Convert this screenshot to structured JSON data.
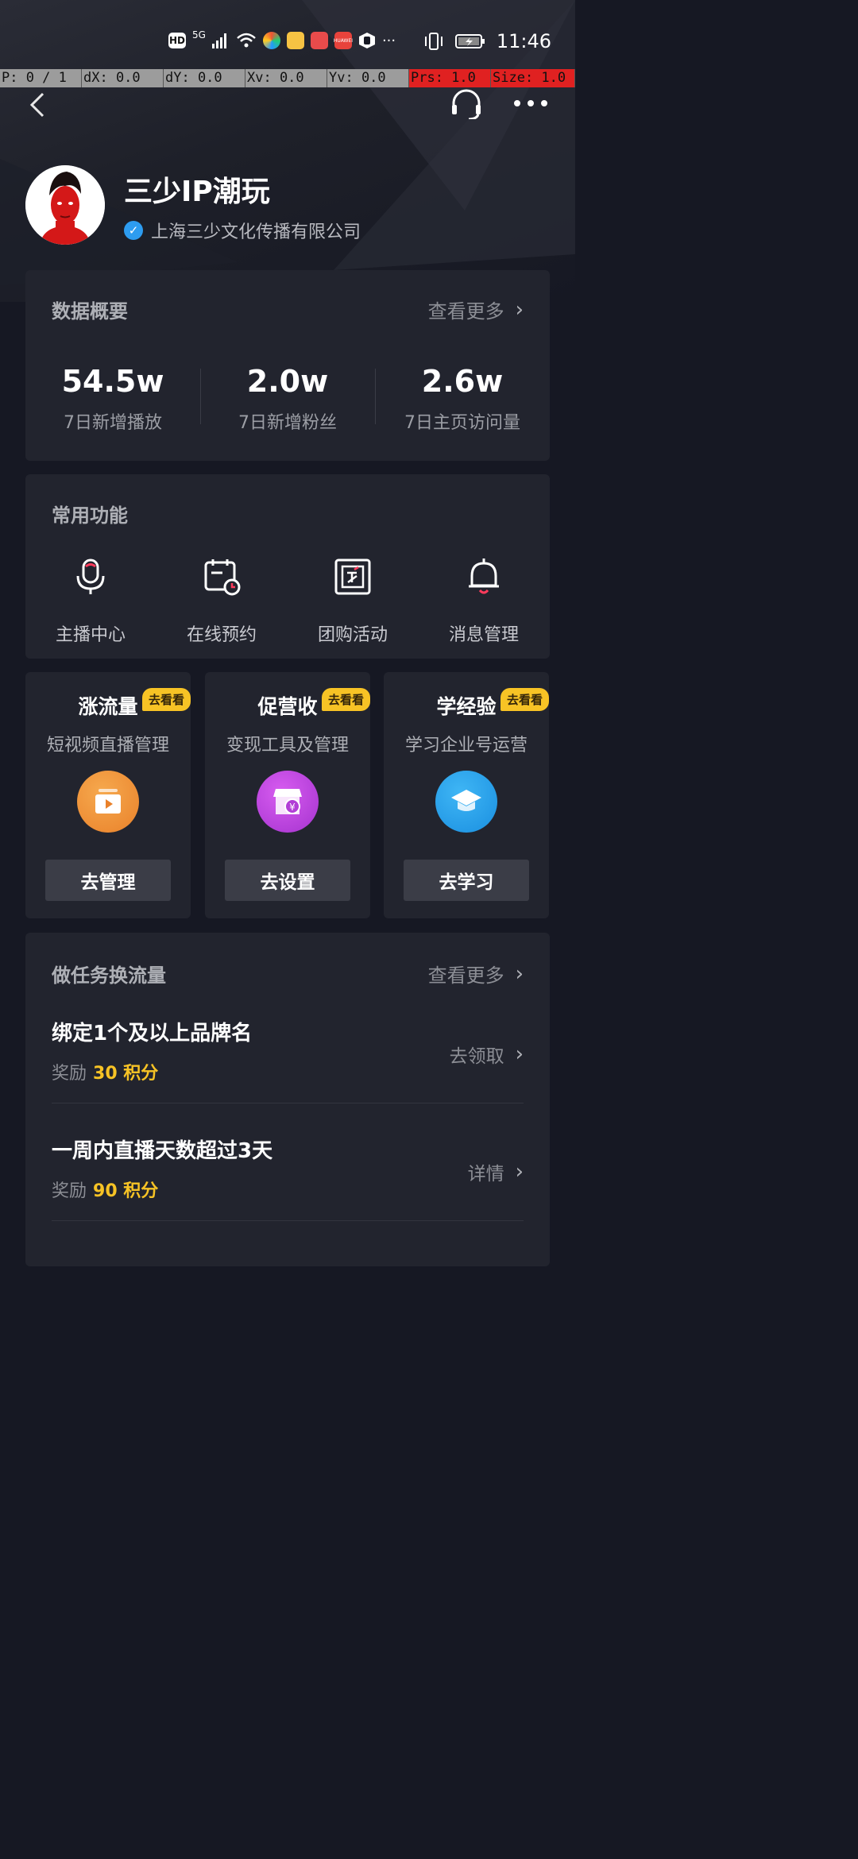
{
  "status_bar": {
    "network": "5G",
    "time": "11:46",
    "icons": [
      "hd-icon",
      "signal-icon",
      "wifi-icon",
      "app-icon",
      "app-icon",
      "book-icon",
      "huawei-icon",
      "hand-icon",
      "dots-icon",
      "vibrate-icon",
      "battery-icon"
    ]
  },
  "debug_bar": {
    "p": "P: 0 / 1",
    "dx": "dX: 0.0",
    "dy": "dY: 0.0",
    "xv": "Xv: 0.0",
    "yv": "Yv: 0.0",
    "prs": "Prs: 1.0",
    "size": "Size: 1.0"
  },
  "profile": {
    "name": "三少IP潮玩",
    "company": "上海三少文化传播有限公司"
  },
  "data_overview": {
    "title": "数据概要",
    "more_label": "查看更多",
    "stats": [
      {
        "value": "54.5w",
        "label": "7日新增播放"
      },
      {
        "value": "2.0w",
        "label": "7日新增粉丝"
      },
      {
        "value": "2.6w",
        "label": "7日主页访问量"
      }
    ]
  },
  "common_functions": {
    "title": "常用功能",
    "items": [
      {
        "label": "主播中心",
        "icon": "microphone-icon"
      },
      {
        "label": "在线预约",
        "icon": "calendar-clock-icon"
      },
      {
        "label": "团购活动",
        "icon": "coupon-icon"
      },
      {
        "label": "消息管理",
        "icon": "bell-icon"
      }
    ]
  },
  "promos": [
    {
      "title": "涨流量",
      "badge": "去看看",
      "subtitle": "短视频直播管理",
      "button": "去管理",
      "icon": "video-play-icon",
      "color": "#f0902f"
    },
    {
      "title": "促营收",
      "badge": "去看看",
      "subtitle": "变现工具及管理",
      "button": "去设置",
      "icon": "shop-yuan-icon",
      "color": "#b642d8"
    },
    {
      "title": "学经验",
      "badge": "去看看",
      "subtitle": "学习企业号运营",
      "button": "去学习",
      "icon": "graduation-cap-icon",
      "color": "#1f9de8"
    }
  ],
  "tasks": {
    "title": "做任务换流量",
    "more_label": "查看更多",
    "reward_prefix": "奖励",
    "items": [
      {
        "title": "绑定1个及以上品牌名",
        "points": "30 积分",
        "action": "去领取"
      },
      {
        "title": "一周内直播天数超过3天",
        "points": "90 积分",
        "action": "详情"
      }
    ]
  }
}
